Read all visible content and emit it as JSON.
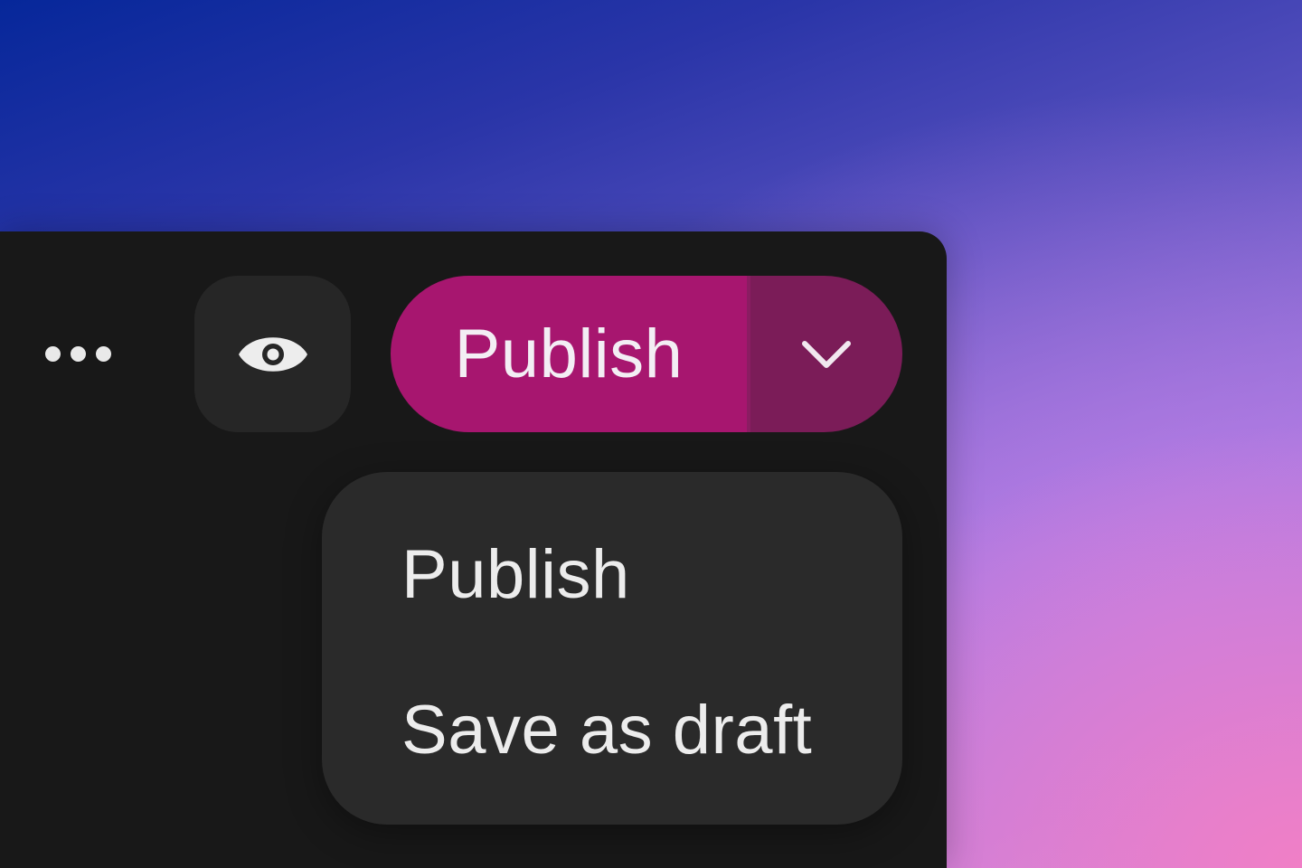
{
  "toolbar": {
    "more_icon": "more-horizontal-icon",
    "preview_icon": "eye-icon",
    "publish_label": "Publish",
    "publish_menu_icon": "chevron-down-icon"
  },
  "publish_menu": {
    "items": [
      {
        "label": "Publish"
      },
      {
        "label": "Save as draft"
      }
    ]
  },
  "colors": {
    "panel": "#181818",
    "icon_button": "#262626",
    "publish_primary": "#a7166f",
    "publish_caret": "#7b1c58",
    "menu_background": "#2a2a2a",
    "text": "#ececec"
  }
}
